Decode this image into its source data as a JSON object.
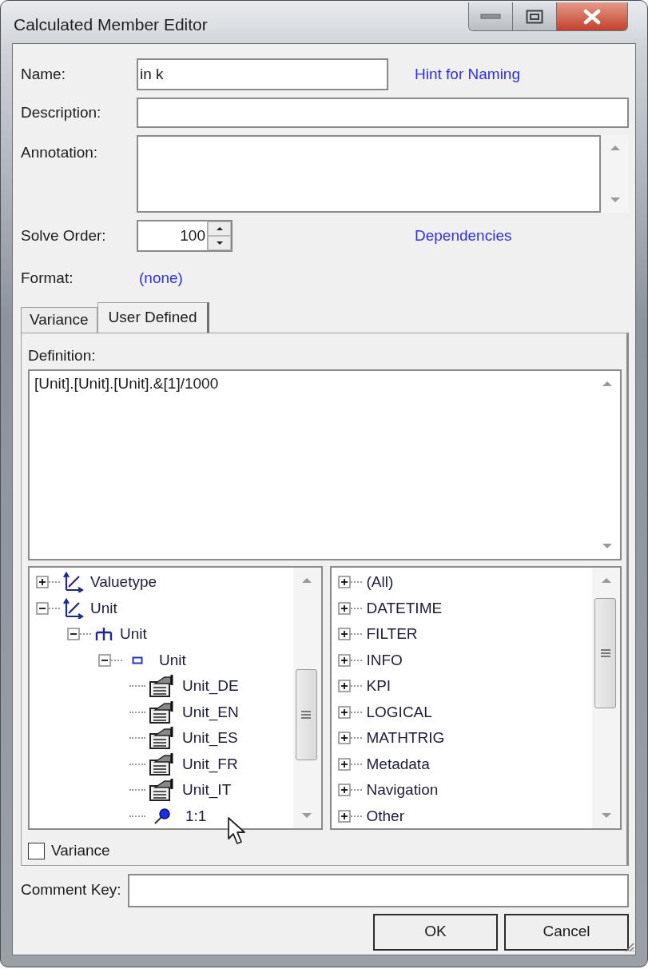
{
  "window": {
    "title": "Calculated Member Editor"
  },
  "name": {
    "label": "Name:",
    "value": "in k"
  },
  "hint_link": "Hint for Naming",
  "description": {
    "label": "Description:"
  },
  "annotation": {
    "label": "Annotation:"
  },
  "solve_order": {
    "label": "Solve Order:",
    "value": "100"
  },
  "dependencies_link": "Dependencies",
  "format": {
    "label": "Format:",
    "value": "(none)"
  },
  "tabs": [
    {
      "label": "Variance",
      "selected": false
    },
    {
      "label": "User Defined",
      "selected": true
    }
  ],
  "definition": {
    "label": "Definition:",
    "value": "[Unit].[Unit].[Unit].&[1]/1000"
  },
  "member_tree": [
    {
      "label": "Valuetype",
      "kind": "dimension",
      "expanded": false
    },
    {
      "label": "Unit",
      "kind": "dimension",
      "expanded": true,
      "children": [
        {
          "label": "Unit",
          "kind": "hierarchy",
          "expanded": true,
          "children": [
            {
              "label": "Unit",
              "kind": "level",
              "expanded": true,
              "children": [
                {
                  "label": "Unit_DE",
                  "kind": "attribute"
                },
                {
                  "label": "Unit_EN",
                  "kind": "attribute"
                },
                {
                  "label": "Unit_ES",
                  "kind": "attribute"
                },
                {
                  "label": "Unit_FR",
                  "kind": "attribute"
                },
                {
                  "label": "Unit_IT",
                  "kind": "attribute"
                },
                {
                  "label": "1:1",
                  "kind": "member"
                }
              ]
            }
          ]
        }
      ]
    }
  ],
  "function_tree": [
    {
      "label": "(All)",
      "expanded": false
    },
    {
      "label": "DATETIME",
      "expanded": false
    },
    {
      "label": "FILTER",
      "expanded": false
    },
    {
      "label": "INFO",
      "expanded": false
    },
    {
      "label": "KPI",
      "expanded": false
    },
    {
      "label": "LOGICAL",
      "expanded": false
    },
    {
      "label": "MATHTRIG",
      "expanded": false
    },
    {
      "label": "Metadata",
      "expanded": false
    },
    {
      "label": "Navigation",
      "expanded": false
    },
    {
      "label": "Other",
      "expanded": false
    }
  ],
  "variance_checkbox": {
    "label": "Variance",
    "checked": false
  },
  "comment_key": {
    "label": "Comment Key:"
  },
  "buttons": [
    {
      "label": "OK"
    },
    {
      "label": "Cancel"
    }
  ]
}
